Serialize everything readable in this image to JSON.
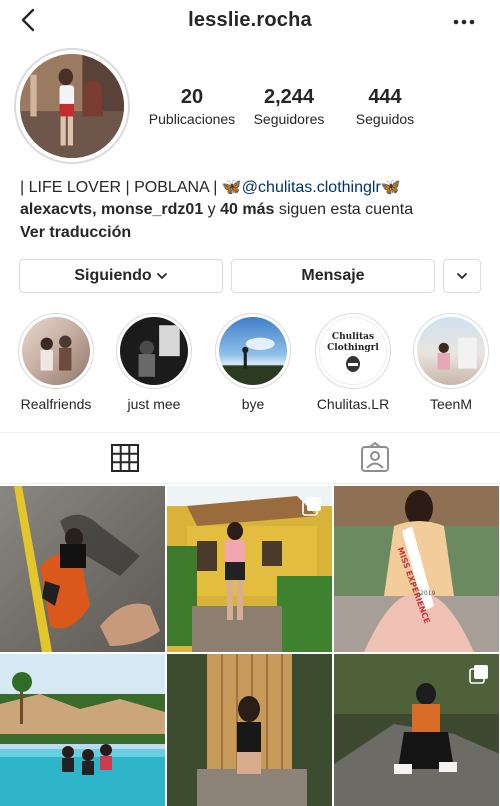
{
  "header": {
    "username": "lesslie.rocha",
    "back_icon": "chevron-left-icon",
    "more_icon": "ellipsis-icon"
  },
  "stats": [
    {
      "number": "20",
      "label": "Publicaciones"
    },
    {
      "number": "2,244",
      "label": "Seguidores"
    },
    {
      "number": "444",
      "label": "Seguidos"
    }
  ],
  "bio": {
    "line1_text": "| LIFE LOVER | POBLANA | ",
    "butterfly": "🦋",
    "handle": "@chulitas.clothinglr",
    "followed_by_names": "alexacvts, monse_rdz01",
    "followed_by_connector": " y ",
    "followed_by_more": "40 más",
    "followed_by_suffix": " siguen esta cuenta",
    "translate": "Ver traducción"
  },
  "actions": {
    "following_label": "Siguiendo",
    "message_label": "Mensaje"
  },
  "highlights": [
    {
      "label": "Realfriends"
    },
    {
      "label": "just mee"
    },
    {
      "label": "bye"
    },
    {
      "label": "Chulitas.LR",
      "logo_line1": "Chulitas",
      "logo_line2": "Clothingrl"
    },
    {
      "label": "TeenM"
    }
  ],
  "tabs": {
    "grid_icon": "grid-icon",
    "tagged_icon": "tagged-person-icon"
  },
  "posts": {
    "miss_sash_text": "MISS EXPERIENCE",
    "miss_sash_year": "2019"
  },
  "colors": {
    "text": "#262626",
    "link": "#003569",
    "border": "#dbdbdb"
  }
}
